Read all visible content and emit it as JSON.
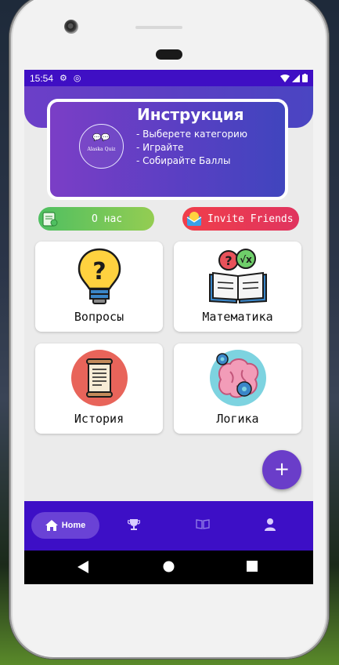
{
  "status_bar": {
    "time": "15:54"
  },
  "instruction": {
    "logo_text": "Alaska Quiz",
    "title": "Инструкция",
    "lines": [
      "- Выберете категорию",
      "- Играйте",
      "- Собирайте Баллы"
    ]
  },
  "actions": {
    "about_label": "О нас",
    "invite_label": "Invite Friends"
  },
  "categories": [
    {
      "label": "Вопросы",
      "icon": "lightbulb-question-icon"
    },
    {
      "label": "Математика",
      "icon": "math-book-icon"
    },
    {
      "label": "История",
      "icon": "scroll-icon"
    },
    {
      "label": "Логика",
      "icon": "brain-gears-icon"
    }
  ],
  "fab": {
    "label": "+"
  },
  "bottom_nav": {
    "home_label": "Home"
  },
  "colors": {
    "primary": "#3d0fc6",
    "accent": "#6a3dc9",
    "green": "#4fbf61",
    "red": "#f03e4a"
  }
}
